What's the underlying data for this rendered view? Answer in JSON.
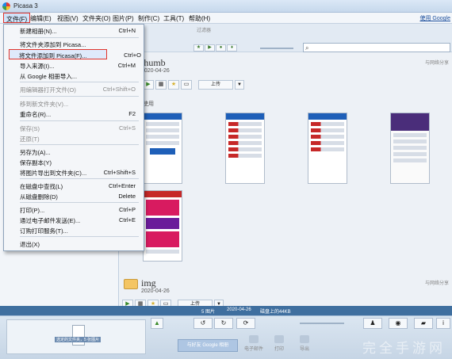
{
  "window": {
    "title": "Picasa 3"
  },
  "menubar": {
    "items": [
      "文件(F)",
      "编辑(E)",
      "视图(V)",
      "文件夹(O)",
      "图片(P)",
      "制作(C)",
      "工具(T)",
      "帮助(H)"
    ],
    "help_link": "使用 Google"
  },
  "file_menu": [
    {
      "label": "新建相册(N)...",
      "shortcut": "Ctrl+N",
      "enabled": true
    },
    {
      "label": "将文件夹添加到 Picasa...",
      "shortcut": "",
      "enabled": true
    },
    {
      "label": "将文件添加到 Picasa(F)...",
      "shortcut": "Ctrl+O",
      "enabled": true,
      "highlighted": true
    },
    {
      "label": "导入来源(I)...",
      "shortcut": "Ctrl+M",
      "enabled": true
    },
    {
      "label": "从 Google 相册导入...",
      "shortcut": "",
      "enabled": true
    },
    {
      "label": "用编辑器打开文件(O)",
      "shortcut": "Ctrl+Shift+O",
      "enabled": false
    },
    {
      "label": "移到新文件夹(V)...",
      "shortcut": "",
      "enabled": false
    },
    {
      "label": "重命名(R)...",
      "shortcut": "F2",
      "enabled": true
    },
    {
      "label": "保存(S)",
      "shortcut": "Ctrl+S",
      "enabled": false
    },
    {
      "label": "还原(T)",
      "shortcut": "",
      "enabled": false
    },
    {
      "label": "另存为(A)...",
      "shortcut": "",
      "enabled": true
    },
    {
      "label": "保存副本(Y)",
      "shortcut": "",
      "enabled": true
    },
    {
      "label": "将图片导出到文件夹(C)...",
      "shortcut": "Ctrl+Shift+S",
      "enabled": true
    },
    {
      "label": "在磁盘中查找(L)",
      "shortcut": "Ctrl+Enter",
      "enabled": true
    },
    {
      "label": "从磁盘删除(D)",
      "shortcut": "Delete",
      "enabled": true
    },
    {
      "label": "打印(P)...",
      "shortcut": "Ctrl+P",
      "enabled": true
    },
    {
      "label": "通过电子邮件发送(E)...",
      "shortcut": "Ctrl+E",
      "enabled": true
    },
    {
      "label": "订购打印服务(T)...",
      "shortcut": "",
      "enabled": true
    },
    {
      "label": "退出(X)",
      "shortcut": "",
      "enabled": true
    }
  ],
  "filterbar": {
    "label": "过滤器"
  },
  "folders": [
    {
      "name": "thumb",
      "date": "2020-04-26",
      "share": "与网络分享",
      "upload": "上传",
      "section": "使用"
    },
    {
      "name": "img",
      "date": "2020-04-26",
      "share": "与网络分享",
      "upload": "上传"
    }
  ],
  "statusbar": {
    "count": "5 图片",
    "date": "2020-04-26",
    "size": "磁盘上的44KB"
  },
  "bottom": {
    "tray_caption": "选定的文件夹，5 张图片",
    "share_button": "与好友 Google 相册",
    "tools": [
      "电子邮件",
      "打印",
      "导出"
    ],
    "watermark": "完全手游网"
  },
  "colors": {
    "highlight_border": "#e0342c",
    "status_bar": "#3f6f9f",
    "menu_active": "#cfe3fa"
  }
}
